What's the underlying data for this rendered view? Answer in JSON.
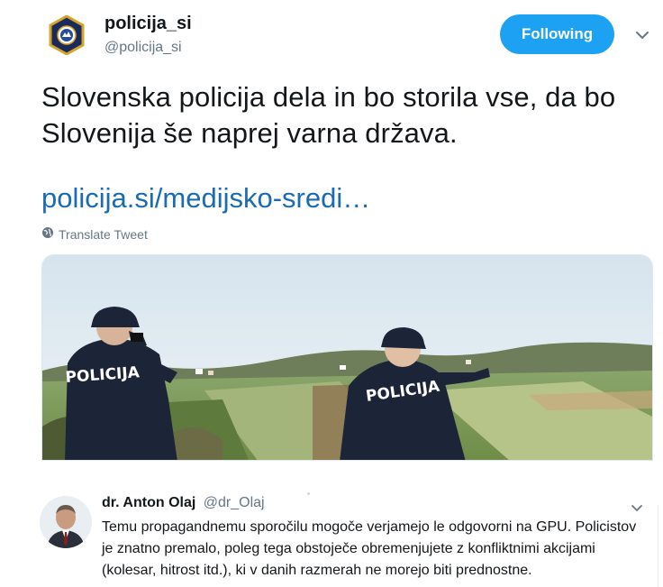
{
  "tweet": {
    "name": "policija_si",
    "handle": "@policija_si",
    "follow_label": "Following",
    "text": "Slovenska policija dela in bo storila vse, da bo Slovenija še naprej varna država.",
    "link": "policija.si/medijsko-sredi…",
    "translate_label": "Translate Tweet",
    "media": {
      "left_badge": "POLICIJA",
      "right_badge": "POLICIJA"
    }
  },
  "reply": {
    "name": "dr. Anton Olaj",
    "handle": "@dr_Olaj",
    "text": "Temu propagandnemu sporočilu mogoče verjamejo le odgovorni na GPU. Policistov je znatno premalo, poleg tega obstoječe obremenjujete z konfliktnimi akcijami (kolesar, hitrost itd.), ki v danih razmerah ne morejo biti prednostne."
  },
  "icons": {
    "main_avatar": "police-badge-icon",
    "caret": "chevron-down-icon",
    "globe": "globe-icon"
  },
  "colors": {
    "accent": "#1da1f2",
    "link": "#1b6bb3",
    "muted": "#657786"
  }
}
